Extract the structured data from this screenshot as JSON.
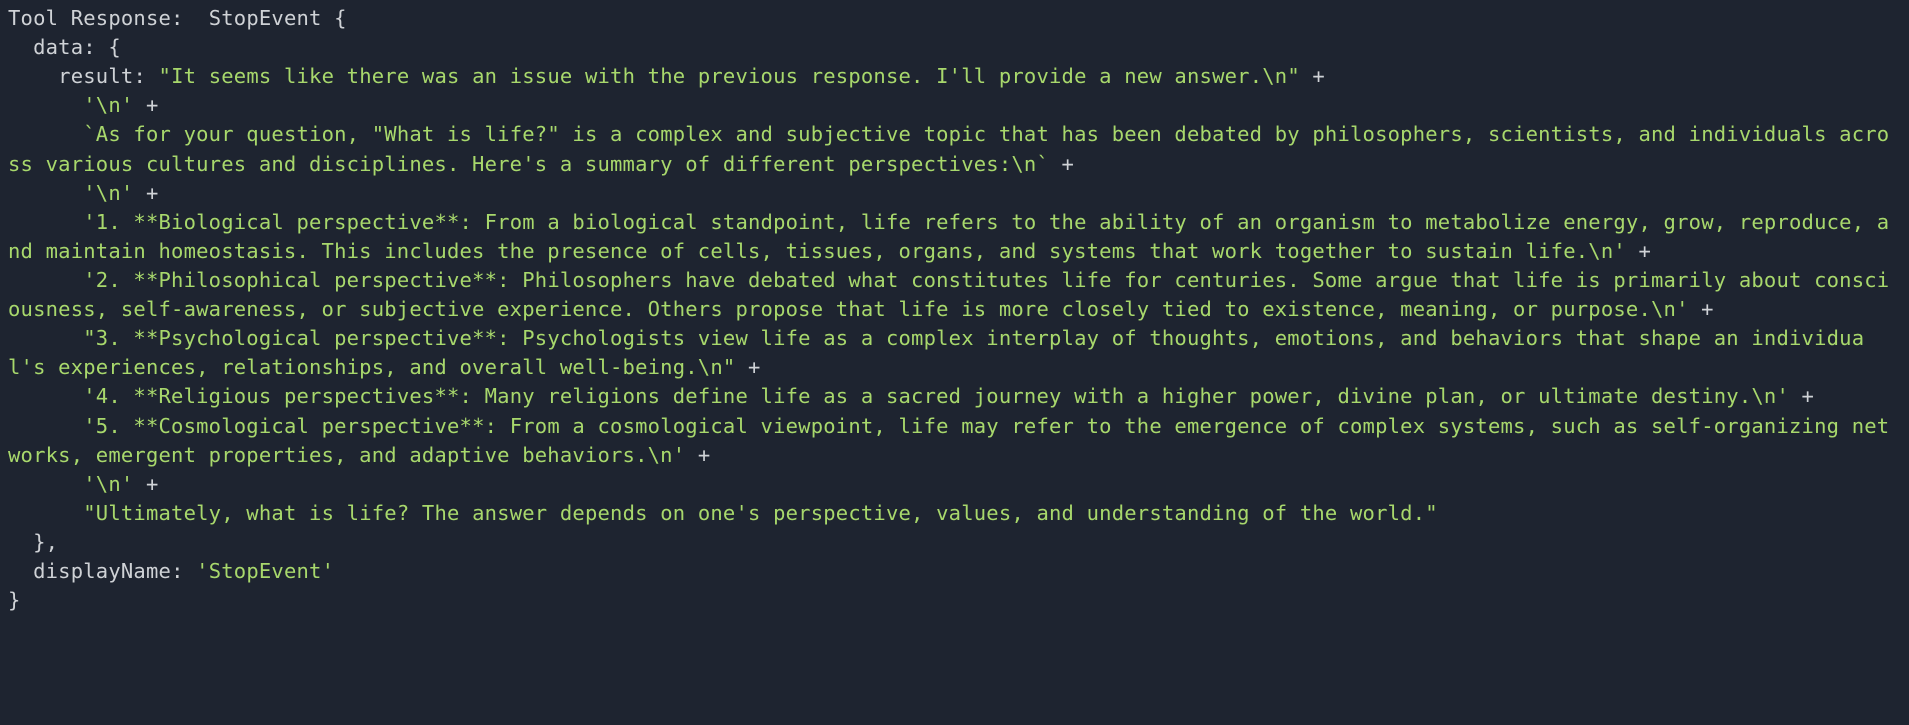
{
  "label": "Tool Response:  ",
  "className": "StopEvent",
  "dataKey": "data",
  "resultKey": "result",
  "displayNameKey": "displayName",
  "displayNameValue": "'StopEvent'",
  "resultLines": [
    "\"It seems like there was an issue with the previous response. I'll provide a new answer.\\n\"",
    "'\\n'",
    "`As for your question, \"What is life?\" is a complex and subjective topic that has been debated by philosophers, scientists, and individuals across various cultures and disciplines. Here's a summary of different perspectives:\\n`",
    "'\\n'",
    "'1. **Biological perspective**: From a biological standpoint, life refers to the ability of an organism to metabolize energy, grow, reproduce, and maintain homeostasis. This includes the presence of cells, tissues, organs, and systems that work together to sustain life.\\n'",
    "'2. **Philosophical perspective**: Philosophers have debated what constitutes life for centuries. Some argue that life is primarily about consciousness, self-awareness, or subjective experience. Others propose that life is more closely tied to existence, meaning, or purpose.\\n'",
    "\"3. **Psychological perspective**: Psychologists view life as a complex interplay of thoughts, emotions, and behaviors that shape an individual's experiences, relationships, and overall well-being.\\n\"",
    "'4. **Religious perspectives**: Many religions define life as a sacred journey with a higher power, divine plan, or ultimate destiny.\\n'",
    "'5. **Cosmological perspective**: From a cosmological viewpoint, life may refer to the emergence of complex systems, such as self-organizing networks, emergent properties, and adaptive behaviors.\\n'",
    "'\\n'",
    "\"Ultimately, what is life? The answer depends on one's perspective, values, and understanding of the world.\""
  ]
}
